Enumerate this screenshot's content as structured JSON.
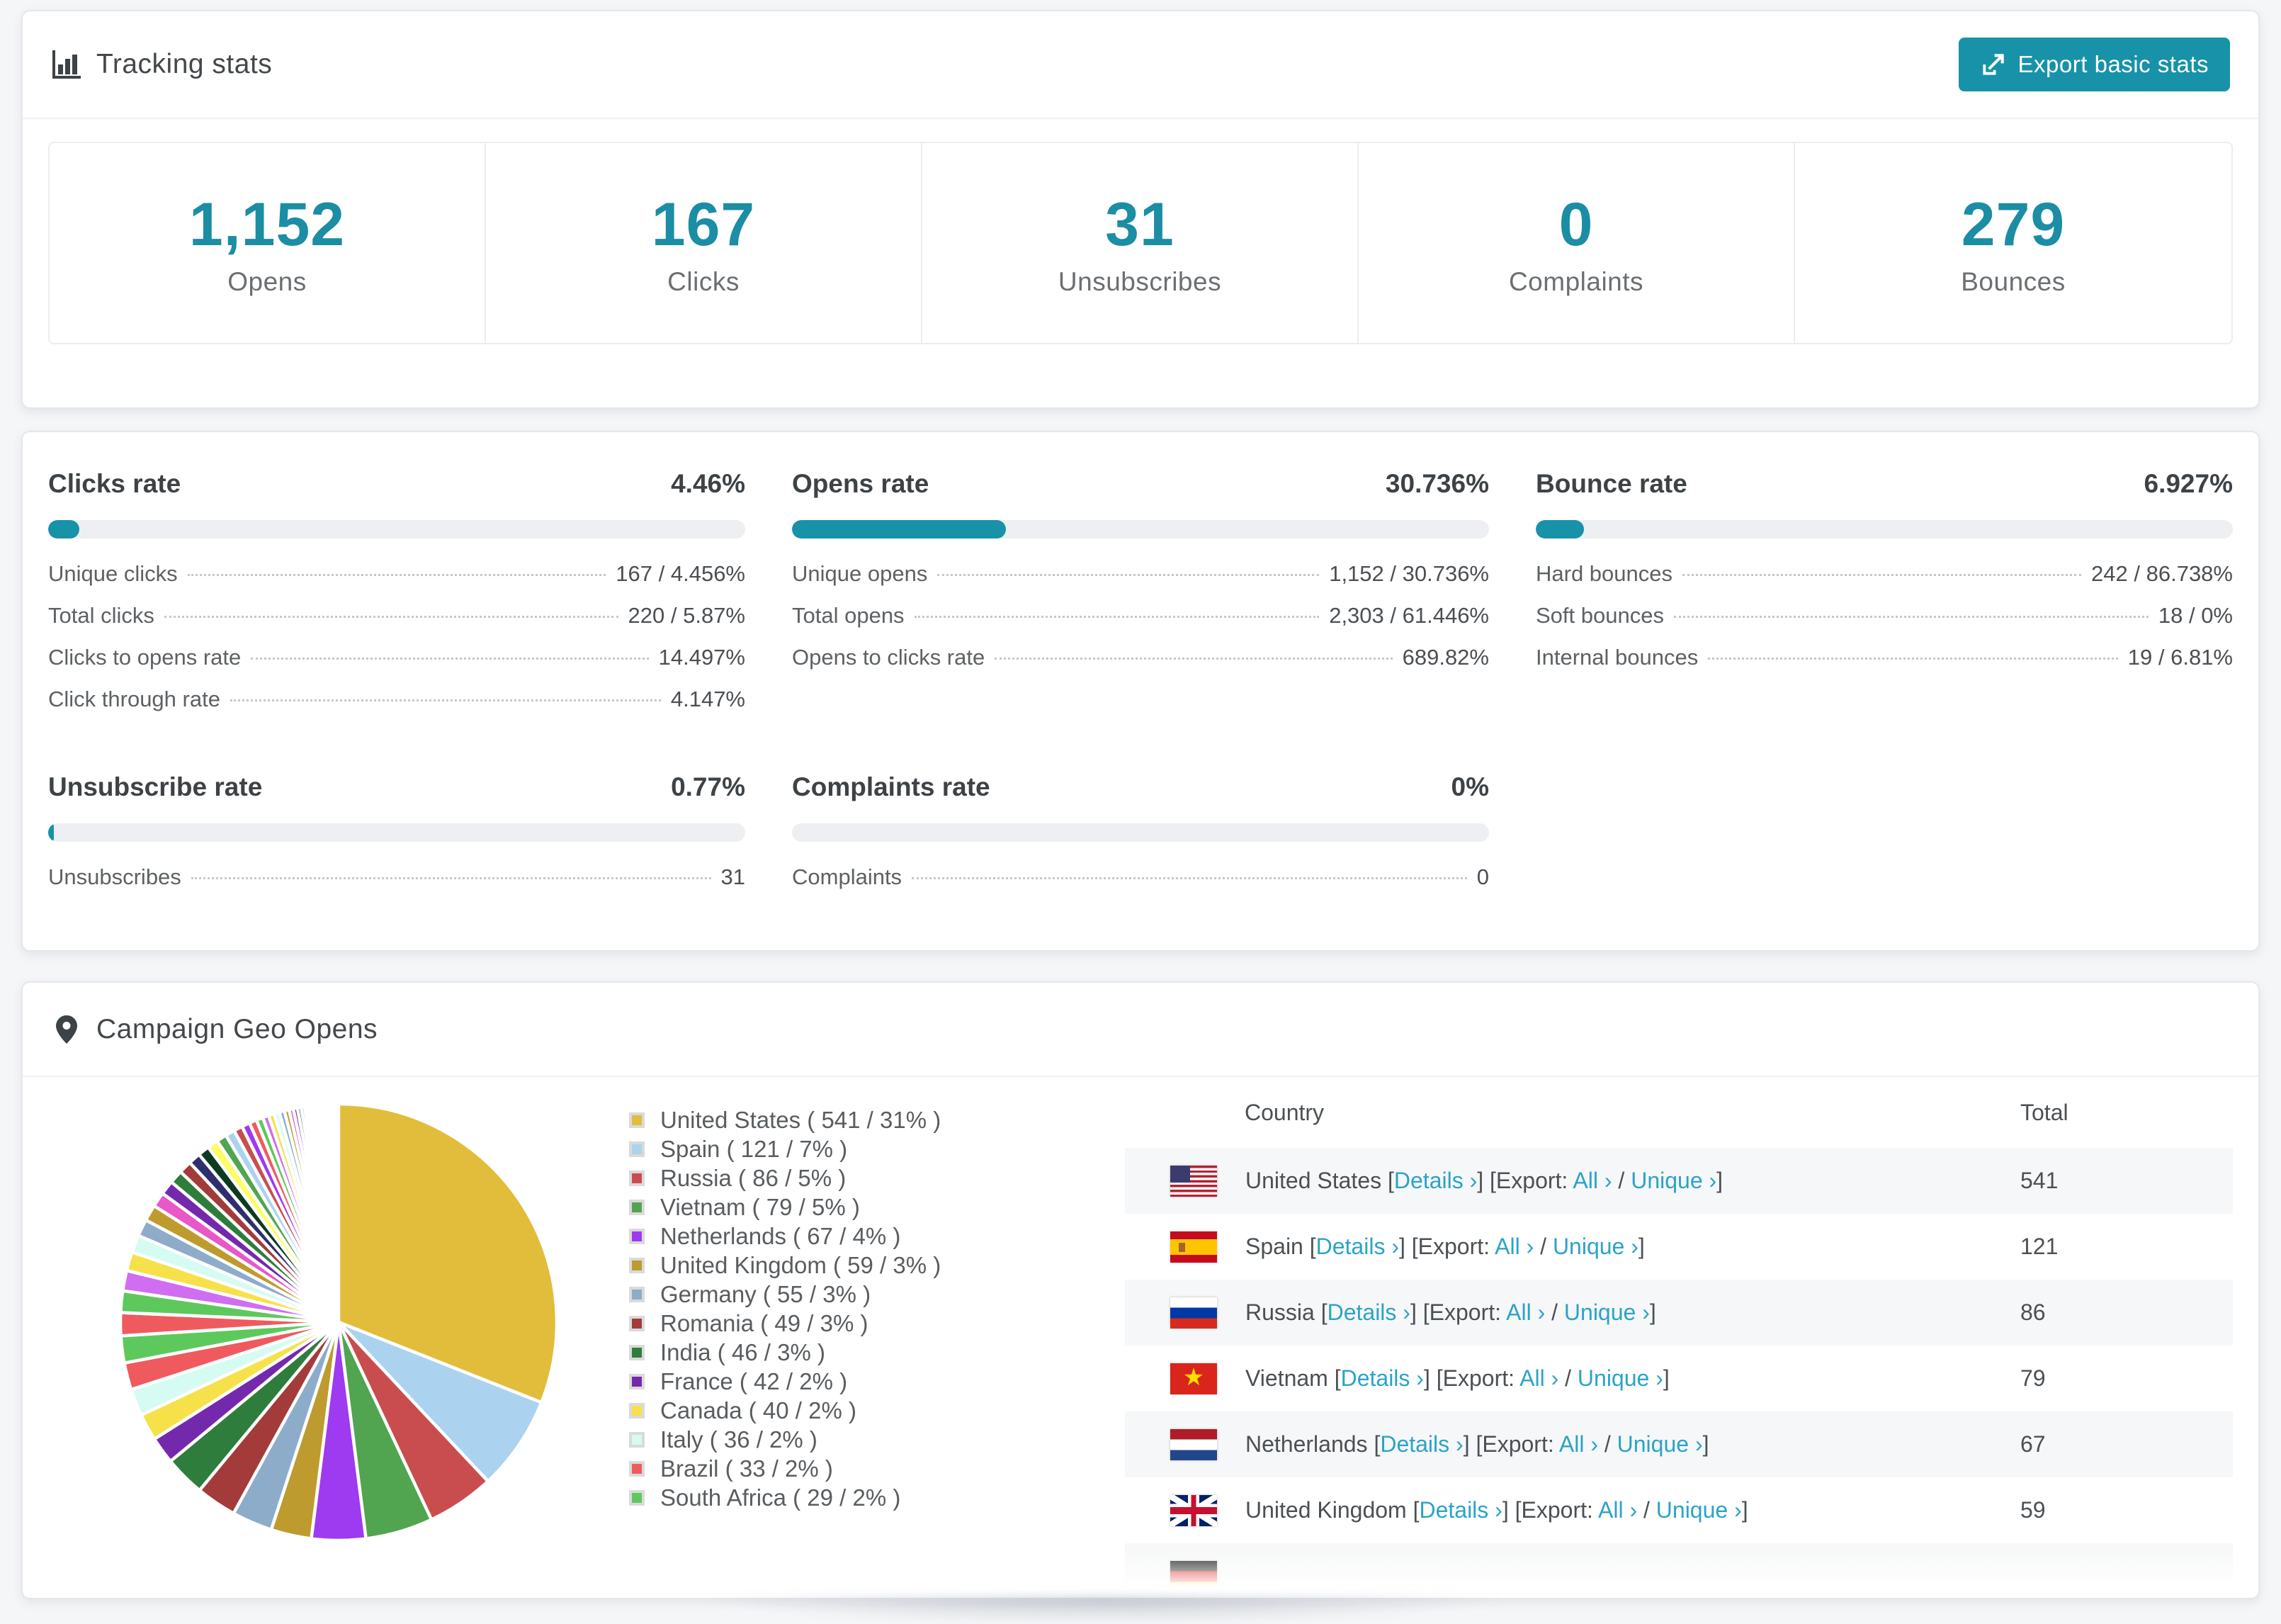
{
  "colors": {
    "accent": "#1b8da4",
    "button": "#1792a9",
    "link": "#2ba3c8",
    "bar_track": "#edeff2",
    "page_bg": "#f5f6f8"
  },
  "tracking": {
    "title": "Tracking stats",
    "export_button": "Export basic stats",
    "stats": [
      {
        "value": "1,152",
        "label": "Opens"
      },
      {
        "value": "167",
        "label": "Clicks"
      },
      {
        "value": "31",
        "label": "Unsubscribes"
      },
      {
        "value": "0",
        "label": "Complaints"
      },
      {
        "value": "279",
        "label": "Bounces"
      }
    ]
  },
  "rates": {
    "clicks": {
      "title": "Clicks rate",
      "value": "4.46%",
      "percent": 4.46,
      "rows": [
        {
          "label": "Unique clicks",
          "value": "167 / 4.456%"
        },
        {
          "label": "Total clicks",
          "value": "220 / 5.87%"
        },
        {
          "label": "Clicks to opens rate",
          "value": "14.497%"
        },
        {
          "label": "Click through rate",
          "value": "4.147%"
        }
      ]
    },
    "opens": {
      "title": "Opens rate",
      "value": "30.736%",
      "percent": 30.736,
      "rows": [
        {
          "label": "Unique opens",
          "value": "1,152 / 30.736%"
        },
        {
          "label": "Total opens",
          "value": "2,303 / 61.446%"
        },
        {
          "label": "Opens to clicks rate",
          "value": "689.82%"
        }
      ]
    },
    "bounce": {
      "title": "Bounce rate",
      "value": "6.927%",
      "percent": 6.927,
      "rows": [
        {
          "label": "Hard bounces",
          "value": "242 / 86.738%"
        },
        {
          "label": "Soft bounces",
          "value": "18 / 0%"
        },
        {
          "label": "Internal bounces",
          "value": "19 / 6.81%"
        }
      ]
    },
    "unsubscribe": {
      "title": "Unsubscribe rate",
      "value": "0.77%",
      "percent": 0.77,
      "rows": [
        {
          "label": "Unsubscribes",
          "value": "31"
        }
      ]
    },
    "complaints": {
      "title": "Complaints rate",
      "value": "0%",
      "percent": 0,
      "rows": [
        {
          "label": "Complaints",
          "value": "0"
        }
      ]
    }
  },
  "geo": {
    "title": "Campaign Geo Opens",
    "table": {
      "headers": {
        "country": "Country",
        "total": "Total"
      },
      "labels": {
        "lb": "[",
        "rb": "]",
        "export": "Export:",
        "slash": "/",
        "details": "Details ›",
        "all": "All ›",
        "unique": "Unique ›"
      },
      "rows": [
        {
          "country": "United States",
          "total": "541",
          "flag": "us"
        },
        {
          "country": "Spain",
          "total": "121",
          "flag": "es"
        },
        {
          "country": "Russia",
          "total": "86",
          "flag": "ru"
        },
        {
          "country": "Vietnam",
          "total": "79",
          "flag": "vn"
        },
        {
          "country": "Netherlands",
          "total": "67",
          "flag": "nl"
        },
        {
          "country": "United Kingdom",
          "total": "59",
          "flag": "uk"
        }
      ],
      "partial_row": {
        "flag": "de"
      }
    }
  },
  "chart_data": {
    "type": "pie",
    "title": "Campaign Geo Opens",
    "legend_position": "right",
    "start_angle_deg": 0,
    "direction": "clockwise",
    "slices": [
      {
        "name": "United States",
        "value": 541,
        "pct": 31,
        "color": "#e2bd3b",
        "label": "United States ( 541 / 31% )"
      },
      {
        "name": "Spain",
        "value": 121,
        "pct": 7,
        "color": "#abd3f0",
        "label": "Spain ( 121 / 7% )"
      },
      {
        "name": "Russia",
        "value": 86,
        "pct": 5,
        "color": "#c94d4f",
        "label": "Russia ( 86 / 5% )"
      },
      {
        "name": "Vietnam",
        "value": 79,
        "pct": 5,
        "color": "#51a551",
        "label": "Vietnam ( 79 / 5% )"
      },
      {
        "name": "Netherlands",
        "value": 67,
        "pct": 4,
        "color": "#9e3af0",
        "label": "Netherlands ( 67 / 4% )"
      },
      {
        "name": "United Kingdom",
        "value": 59,
        "pct": 3,
        "color": "#bd9b2e",
        "label": "United Kingdom ( 59 / 3% )"
      },
      {
        "name": "Germany",
        "value": 55,
        "pct": 3,
        "color": "#8cacca",
        "label": "Germany ( 55 / 3% )"
      },
      {
        "name": "Romania",
        "value": 49,
        "pct": 3,
        "color": "#a33b3b",
        "label": "Romania ( 49 / 3% )"
      },
      {
        "name": "India",
        "value": 46,
        "pct": 3,
        "color": "#2f7d3c",
        "label": "India ( 46 / 3% )"
      },
      {
        "name": "France",
        "value": 42,
        "pct": 2,
        "color": "#7429ad",
        "label": "France ( 42 / 2% )"
      },
      {
        "name": "Canada",
        "value": 40,
        "pct": 2,
        "color": "#f7e14a",
        "label": "Canada ( 40 / 2% )"
      },
      {
        "name": "Italy",
        "value": 36,
        "pct": 2,
        "color": "#d6fbf2",
        "label": "Italy ( 36 / 2% )"
      },
      {
        "name": "Brazil",
        "value": 33,
        "pct": 2,
        "color": "#ef5a5e",
        "label": "Brazil ( 33 / 2% )"
      },
      {
        "name": "South Africa",
        "value": 29,
        "pct": 2,
        "color": "#5dc95d",
        "label": "South Africa ( 29 / 2% )"
      }
    ],
    "other_slices": {
      "note": "unlabeled small countries, ~25% combined",
      "values": [
        1.7,
        1.6,
        1.5,
        1.4,
        1.3,
        1.25,
        1.2,
        1.1,
        1.05,
        1.0,
        0.95,
        0.9,
        0.85,
        0.8,
        0.75,
        0.7,
        0.65,
        0.6,
        0.55,
        0.5,
        0.45,
        0.42,
        0.4,
        0.38,
        0.35,
        0.32,
        0.3,
        0.28,
        0.25,
        0.22,
        0.2,
        0.18,
        0.16,
        0.14,
        0.12,
        0.1,
        0.09,
        0.08,
        0.07,
        0.06,
        0.05,
        0.04
      ],
      "palette": [
        "#ef5a5e",
        "#5dc95d",
        "#d06df0",
        "#f7e14a",
        "#d6fbf2",
        "#8cacca",
        "#bd9b2e",
        "#e858c8",
        "#7429ad",
        "#2f7d3c",
        "#a33b3b",
        "#2f2f6e",
        "#0d3b22",
        "#fdfd66",
        "#51a551",
        "#abd3f0",
        "#c94d4f",
        "#9e3af0"
      ]
    }
  }
}
